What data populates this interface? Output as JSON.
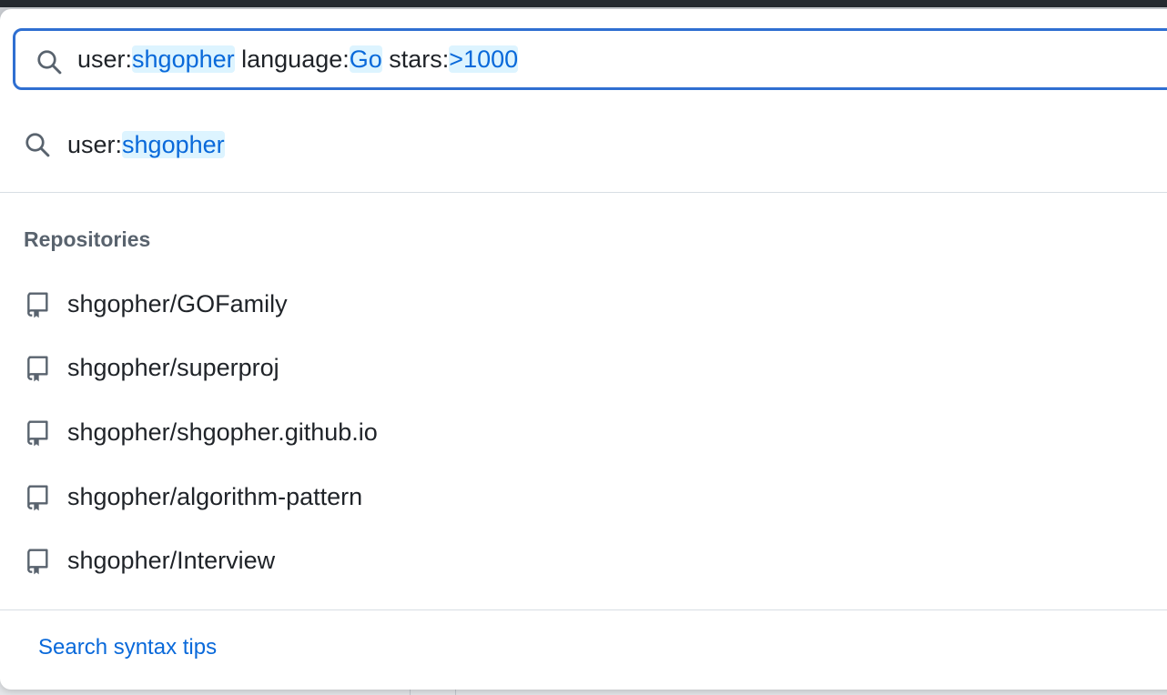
{
  "search": {
    "query_tokens": [
      {
        "key": "user:",
        "value": "shgopher"
      },
      {
        "key": " language:",
        "value": "Go"
      },
      {
        "key": " stars:",
        "value": ">1000"
      }
    ]
  },
  "suggestion": {
    "key": "user:",
    "value": "shgopher"
  },
  "repositories": {
    "title": "Repositories",
    "items": [
      "shgopher/GOFamily",
      "shgopher/superproj",
      "shgopher/shgopher.github.io",
      "shgopher/algorithm-pattern",
      "shgopher/Interview"
    ]
  },
  "footer": {
    "tips_label": "Search syntax tips"
  },
  "colors": {
    "accent": "#0969da",
    "focus_border": "#2f6fd1",
    "token_bg": "#ddf4ff"
  },
  "icons": {
    "search": "search-icon",
    "repo": "repo-icon"
  }
}
